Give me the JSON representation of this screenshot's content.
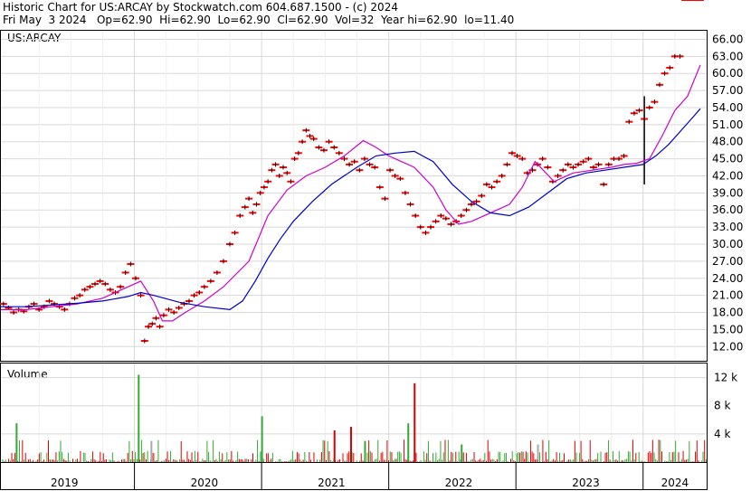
{
  "header": {
    "title_line": "Historic Chart for US:ARCAY by Stockwatch.com 604.687.1500 - (c) 2024",
    "quote_line": "Fri May  3 2024   Op=62.90  Hi=62.90  Lo=62.90  Cl=62.90  Vol=32  Year hi=62.90  lo=11.40"
  },
  "chart_data": [
    {
      "type": "line",
      "panel_label": "US:ARCAY",
      "ylim": [
        9.5,
        67.5
      ],
      "yticks": [
        "12.00",
        "15.00",
        "18.00",
        "21.00",
        "24.00",
        "27.00",
        "30.00",
        "33.00",
        "36.00",
        "39.00",
        "42.00",
        "45.00",
        "48.00",
        "51.00",
        "54.00",
        "57.00",
        "60.00",
        "63.00",
        "66.00"
      ],
      "x_labels": [
        "2019",
        "2020",
        "2021",
        "2022",
        "2023",
        "2024"
      ],
      "x_label_years": [
        2019.4,
        2020.5,
        2021.5,
        2022.5,
        2023.5,
        2024.2
      ],
      "year_dividers": [
        2019.95,
        2020.95,
        2021.95,
        2022.95,
        2023.95
      ],
      "xlim": [
        2018.9,
        2024.45
      ],
      "grid": true,
      "price_color": "#ff0000",
      "series": [
        {
          "color": "#cc00cc",
          "x": [
            2018.9,
            2019.1,
            2019.3,
            2019.5,
            2019.7,
            2019.85,
            2020.0,
            2020.1,
            2020.17,
            2020.25,
            2020.35,
            2020.5,
            2020.65,
            2020.85,
            2021.0,
            2021.15,
            2021.3,
            2021.45,
            2021.6,
            2021.75,
            2021.85,
            2021.95,
            2022.05,
            2022.15,
            2022.3,
            2022.4,
            2022.5,
            2022.6,
            2022.75,
            2022.9,
            2023.0,
            2023.1,
            2023.25,
            2023.4,
            2023.55,
            2023.7,
            2023.8,
            2023.9,
            2024.0,
            2024.1,
            2024.2,
            2024.3,
            2024.4
          ],
          "y": [
            18.5,
            18.5,
            19.0,
            19.5,
            20.5,
            22.0,
            23.5,
            20.0,
            16.5,
            16.5,
            18.0,
            20.0,
            22.5,
            27.0,
            35.0,
            39.5,
            42.0,
            43.5,
            45.5,
            48.2,
            47.0,
            45.5,
            44.5,
            43.5,
            40.0,
            36.0,
            33.5,
            34.0,
            35.5,
            37.0,
            40.0,
            44.5,
            41.0,
            42.5,
            43.0,
            43.5,
            44.0,
            44.2,
            45.0,
            49.0,
            53.5,
            56.0,
            61.5
          ]
        },
        {
          "color": "#0000cc",
          "x": [
            2018.9,
            2019.1,
            2019.3,
            2019.5,
            2019.7,
            2019.9,
            2020.0,
            2020.1,
            2020.3,
            2020.5,
            2020.7,
            2020.8,
            2020.9,
            2021.0,
            2021.1,
            2021.2,
            2021.35,
            2021.5,
            2021.7,
            2021.85,
            2022.0,
            2022.15,
            2022.3,
            2022.45,
            2022.6,
            2022.75,
            2022.9,
            2023.05,
            2023.2,
            2023.35,
            2023.5,
            2023.65,
            2023.8,
            2023.95,
            2024.05,
            2024.15,
            2024.25,
            2024.35,
            2024.4
          ],
          "y": [
            19.0,
            19.0,
            19.3,
            19.6,
            20.0,
            20.8,
            21.5,
            21.0,
            19.8,
            19.0,
            18.5,
            20.0,
            23.5,
            27.5,
            31.0,
            34.0,
            37.5,
            40.5,
            43.5,
            45.5,
            46.0,
            46.3,
            44.5,
            40.5,
            37.5,
            35.5,
            35.0,
            36.5,
            39.0,
            41.5,
            42.5,
            43.0,
            43.5,
            44.0,
            45.5,
            47.5,
            50.0,
            52.5,
            53.8
          ]
        }
      ],
      "price_points": {
        "x": [
          2018.92,
          2018.96,
          2019.0,
          2019.04,
          2019.08,
          2019.12,
          2019.16,
          2019.2,
          2019.24,
          2019.28,
          2019.32,
          2019.36,
          2019.4,
          2019.44,
          2019.48,
          2019.52,
          2019.56,
          2019.6,
          2019.64,
          2019.68,
          2019.72,
          2019.76,
          2019.8,
          2019.84,
          2019.88,
          2019.92,
          2019.96,
          2020.0,
          2020.03,
          2020.06,
          2020.09,
          2020.12,
          2020.15,
          2020.18,
          2020.22,
          2020.26,
          2020.3,
          2020.34,
          2020.38,
          2020.42,
          2020.46,
          2020.5,
          2020.55,
          2020.6,
          2020.65,
          2020.7,
          2020.74,
          2020.78,
          2020.82,
          2020.85,
          2020.88,
          2020.91,
          2020.94,
          2020.97,
          2021.0,
          2021.03,
          2021.06,
          2021.09,
          2021.12,
          2021.15,
          2021.18,
          2021.21,
          2021.24,
          2021.27,
          2021.3,
          2021.33,
          2021.36,
          2021.4,
          2021.44,
          2021.48,
          2021.52,
          2021.56,
          2021.6,
          2021.64,
          2021.68,
          2021.72,
          2021.76,
          2021.8,
          2021.84,
          2021.88,
          2021.92,
          2021.96,
          2022.0,
          2022.04,
          2022.08,
          2022.12,
          2022.16,
          2022.2,
          2022.24,
          2022.28,
          2022.32,
          2022.36,
          2022.4,
          2022.44,
          2022.48,
          2022.52,
          2022.56,
          2022.6,
          2022.64,
          2022.68,
          2022.72,
          2022.76,
          2022.8,
          2022.84,
          2022.88,
          2022.92,
          2022.96,
          2023.0,
          2023.04,
          2023.08,
          2023.12,
          2023.16,
          2023.2,
          2023.24,
          2023.28,
          2023.32,
          2023.36,
          2023.4,
          2023.44,
          2023.48,
          2023.52,
          2023.56,
          2023.6,
          2023.64,
          2023.68,
          2023.72,
          2023.76,
          2023.8,
          2023.84,
          2023.88,
          2023.92,
          2023.96,
          2024.0,
          2024.04,
          2024.08,
          2024.12,
          2024.16,
          2024.2,
          2024.24,
          2024.28,
          2024.32,
          2024.36,
          2024.4
        ],
        "y": [
          19.5,
          18.8,
          18.0,
          18.5,
          18.2,
          19.0,
          19.5,
          18.5,
          19.0,
          20.0,
          19.5,
          19.0,
          18.5,
          19.5,
          20.5,
          21.0,
          22.0,
          22.5,
          23.0,
          23.5,
          23.0,
          22.0,
          21.5,
          22.5,
          25.0,
          26.5,
          24.0,
          21.0,
          13.0,
          15.5,
          16.0,
          17.0,
          15.5,
          17.5,
          18.5,
          18.0,
          18.8,
          19.5,
          20.0,
          21.0,
          21.5,
          22.5,
          23.5,
          25.0,
          27.0,
          30.0,
          32.0,
          35.0,
          36.5,
          38.0,
          35.5,
          37.0,
          39.0,
          40.0,
          41.0,
          43.0,
          44.0,
          42.0,
          43.5,
          42.5,
          41.0,
          45.0,
          46.0,
          48.0,
          50.0,
          49.0,
          48.5,
          47.0,
          46.5,
          48.0,
          47.0,
          46.0,
          45.0,
          44.0,
          44.5,
          43.0,
          45.0,
          44.0,
          43.5,
          40.0,
          38.0,
          43.0,
          42.0,
          41.5,
          39.0,
          37.0,
          35.0,
          33.0,
          32.0,
          33.0,
          34.0,
          35.0,
          34.5,
          33.5,
          34.0,
          35.0,
          36.0,
          37.0,
          37.5,
          38.5,
          40.5,
          40.0,
          41.0,
          42.0,
          44.0,
          46.0,
          45.5,
          45.0,
          42.5,
          43.0,
          44.0,
          45.0,
          43.5,
          41.0,
          42.0,
          43.0,
          44.0,
          43.5,
          44.0,
          44.5,
          45.0,
          43.5,
          44.0,
          40.5,
          44.0,
          45.0,
          45.0,
          45.5,
          51.5,
          53.0,
          53.5,
          52.0,
          54.0,
          55.0,
          58.0,
          60.0,
          61.0,
          63.0,
          63.0
        ],
        "tall_bar": [
          2023.96,
          40.5,
          56.0
        ]
      }
    },
    {
      "type": "bar",
      "panel_label": "Volume",
      "yticks": [
        "4 k",
        "8 k",
        "12 k"
      ],
      "ylim": [
        0,
        14
      ],
      "big_bars": [
        {
          "x": 2019.02,
          "v": 5.5,
          "color": "#33aa33"
        },
        {
          "x": 2019.98,
          "v": 12.4,
          "color": "#33aa33"
        },
        {
          "x": 2020.08,
          "v": 3.0,
          "color": "#aaaaaa"
        },
        {
          "x": 2020.95,
          "v": 6.5,
          "color": "#33aa33"
        },
        {
          "x": 2021.52,
          "v": 4.5,
          "color": "#dd0000"
        },
        {
          "x": 2021.65,
          "v": 5.0,
          "color": "#dd0000"
        },
        {
          "x": 2021.76,
          "v": 3.0,
          "color": "#33aa33"
        },
        {
          "x": 2022.1,
          "v": 5.5,
          "color": "#33aa33"
        },
        {
          "x": 2022.15,
          "v": 11.2,
          "color": "#dd0000"
        },
        {
          "x": 2022.52,
          "v": 2.5,
          "color": "#33aa33"
        },
        {
          "x": 2023.12,
          "v": 2.5,
          "color": "#aaaaaa"
        }
      ]
    }
  ]
}
